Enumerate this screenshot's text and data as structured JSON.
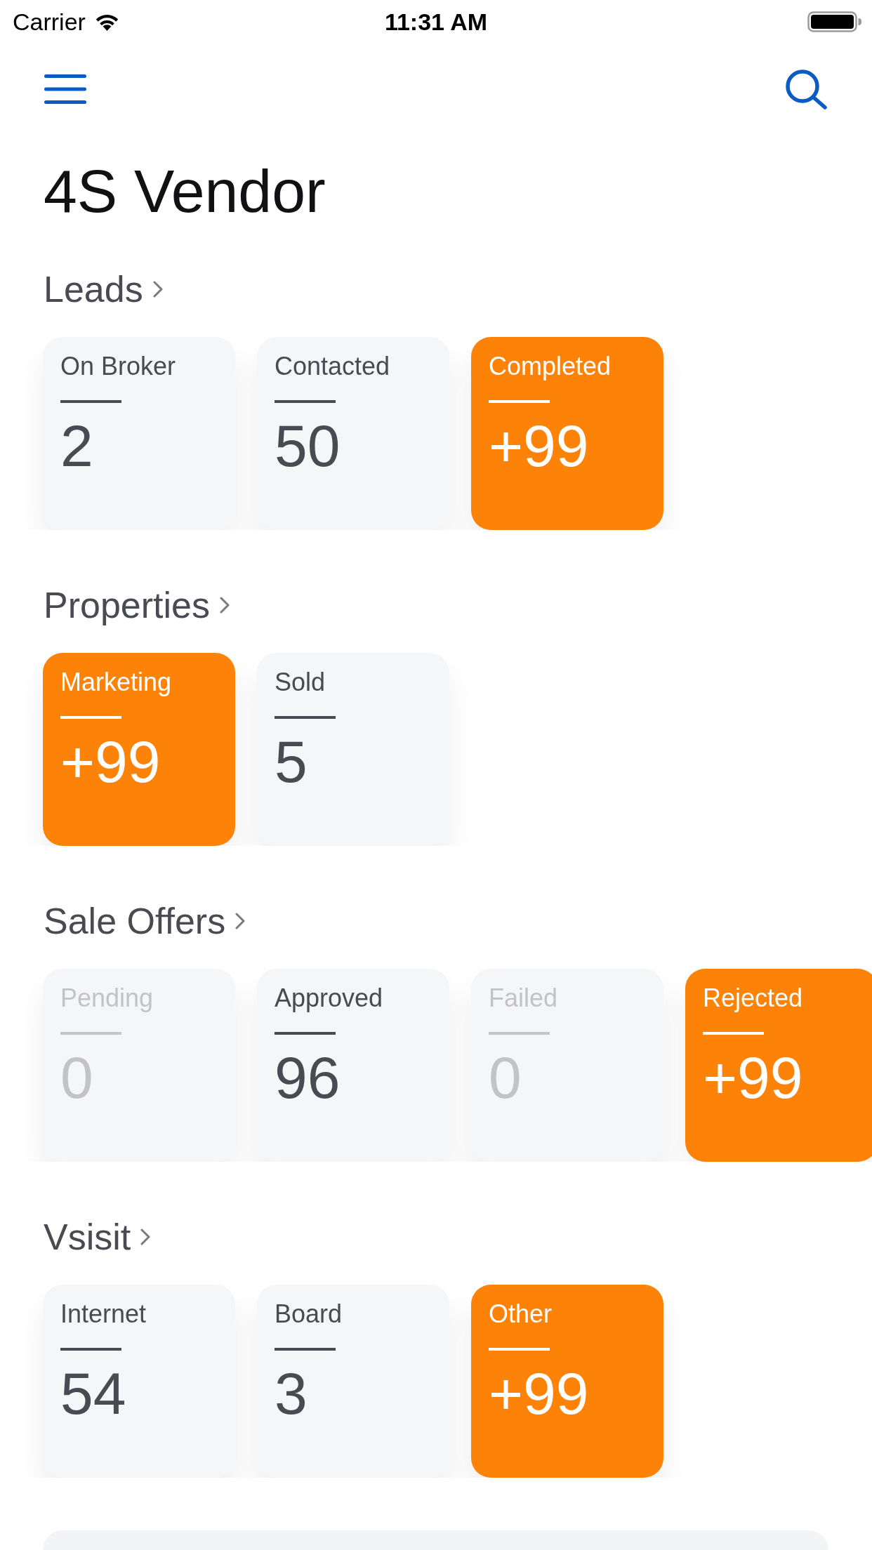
{
  "status_bar": {
    "carrier": "Carrier",
    "time": "11:31 AM"
  },
  "title": "4S Vendor",
  "sections": [
    {
      "title": "Leads",
      "cards": [
        {
          "label": "On Broker",
          "value": "2",
          "highlighted": false,
          "disabled": false
        },
        {
          "label": "Contacted",
          "value": "50",
          "highlighted": false,
          "disabled": false
        },
        {
          "label": "Completed",
          "value": "+99",
          "highlighted": true,
          "disabled": false
        }
      ]
    },
    {
      "title": "Properties",
      "cards": [
        {
          "label": "Marketing",
          "value": "+99",
          "highlighted": true,
          "disabled": false
        },
        {
          "label": "Sold",
          "value": "5",
          "highlighted": false,
          "disabled": false
        }
      ]
    },
    {
      "title": "Sale Offers",
      "cards": [
        {
          "label": "Pending",
          "value": "0",
          "highlighted": false,
          "disabled": true
        },
        {
          "label": "Approved",
          "value": "96",
          "highlighted": false,
          "disabled": false
        },
        {
          "label": "Failed",
          "value": "0",
          "highlighted": false,
          "disabled": true
        },
        {
          "label": "Rejected",
          "value": "+99",
          "highlighted": true,
          "disabled": false
        }
      ]
    },
    {
      "title": "Vsisit",
      "cards": [
        {
          "label": "Internet",
          "value": "54",
          "highlighted": false,
          "disabled": false
        },
        {
          "label": "Board",
          "value": "3",
          "highlighted": false,
          "disabled": false
        },
        {
          "label": "Other",
          "value": "+99",
          "highlighted": true,
          "disabled": false
        }
      ]
    }
  ]
}
